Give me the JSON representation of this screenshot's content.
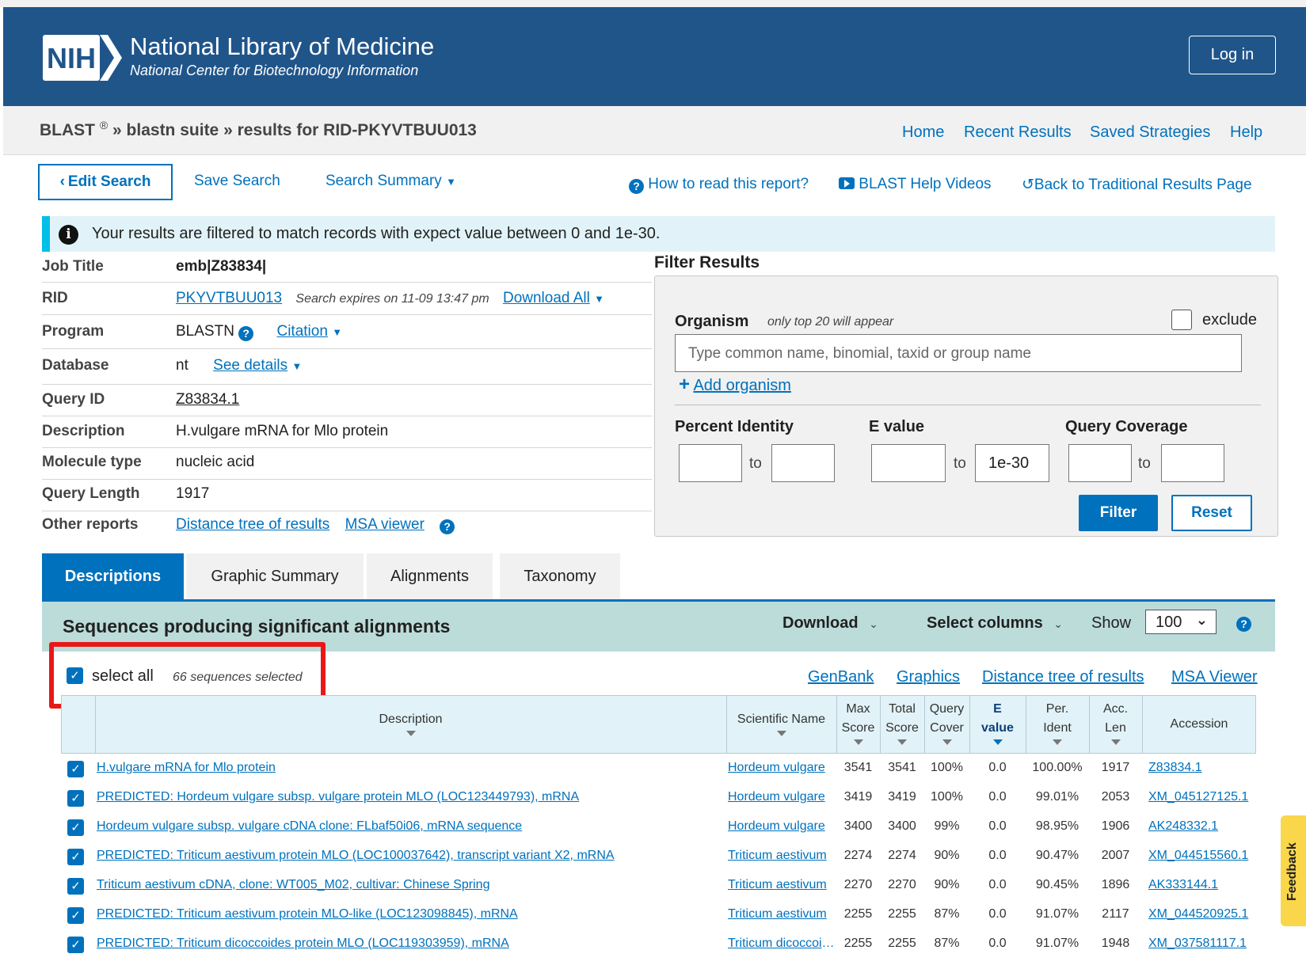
{
  "header": {
    "logo_text": "NIH",
    "title": "National Library of Medicine",
    "subtitle": "National Center for Biotechnology Information",
    "login_label": "Log in"
  },
  "breadcrumb": {
    "brand": "BLAST",
    "reg": "®",
    "sep1": "»",
    "suite": "blastn suite",
    "sep2": "»",
    "results": "results for RID-PKYVTBUU013"
  },
  "topnav": [
    "Home",
    "Recent Results",
    "Saved Strategies",
    "Help"
  ],
  "toolbar": {
    "edit_search": "Edit Search",
    "save_search": "Save Search",
    "search_summary": "Search Summary",
    "how_to_read": "How to read this report?",
    "help_videos": "BLAST Help Videos",
    "back_traditional": "Back to Traditional Results Page"
  },
  "info_banner": "Your results are filtered to match records with expect value between 0 and 1e-30.",
  "job": {
    "labels": [
      "Job Title",
      "RID",
      "Program",
      "Database",
      "Query ID",
      "Description",
      "Molecule type",
      "Query Length",
      "Other reports"
    ],
    "job_title": "emb|Z83834|",
    "rid": "PKYVTBUU013",
    "rid_expires": "Search expires on 11-09 13:47 pm",
    "download_all": "Download All",
    "program": "BLASTN",
    "citation": "Citation",
    "database": "nt",
    "see_details": "See details",
    "query_id": "Z83834.1",
    "description": "H.vulgare mRNA for Mlo protein",
    "molecule_type": "nucleic acid",
    "query_length": "1917",
    "distance_tree": "Distance tree of results",
    "msa_viewer": "MSA viewer"
  },
  "filter": {
    "title": "Filter Results",
    "organism_label": "Organism",
    "organism_hint": "only top 20 will appear",
    "exclude_label": "exclude",
    "organism_placeholder": "Type common  name, binomial, taxid or group  name",
    "add_organism": "Add organism",
    "percent_identity": "Percent Identity",
    "e_value": "E value",
    "query_coverage": "Query Coverage",
    "to": "to",
    "e_value_to": "1e-30",
    "filter_btn": "Filter",
    "reset_btn": "Reset"
  },
  "tabs": [
    "Descriptions",
    "Graphic Summary",
    "Alignments",
    "Taxonomy"
  ],
  "results": {
    "title": "Sequences producing significant alignments",
    "download": "Download",
    "select_columns": "Select columns",
    "show": "Show",
    "show_value": "100",
    "select_all": "select all",
    "selected_count": "66 sequences selected",
    "links": [
      "GenBank",
      "Graphics",
      "Distance tree of results",
      "MSA Viewer"
    ]
  },
  "table": {
    "headers": {
      "description": "Description",
      "scientific_name": "Scientific Name",
      "max_score": [
        "Max",
        "Score"
      ],
      "total_score": [
        "Total",
        "Score"
      ],
      "query_cover": [
        "Query",
        "Cover"
      ],
      "e_value": [
        "E",
        "value"
      ],
      "per_ident": [
        "Per.",
        "Ident"
      ],
      "acc_len": [
        "Acc.",
        "Len"
      ],
      "accession": "Accession"
    },
    "rows": [
      {
        "desc": "H.vulgare mRNA for Mlo protein",
        "sci": "Hordeum vulgare",
        "max": "3541",
        "total": "3541",
        "cover": "100%",
        "e": "0.0",
        "ident": "100.00%",
        "len": "1917",
        "acc": "Z83834.1"
      },
      {
        "desc": "PREDICTED: Hordeum vulgare subsp. vulgare protein MLO (LOC123449793), mRNA",
        "sci": "Hordeum vulgare",
        "max": "3419",
        "total": "3419",
        "cover": "100%",
        "e": "0.0",
        "ident": "99.01%",
        "len": "2053",
        "acc": "XM_045127125.1"
      },
      {
        "desc": "Hordeum vulgare subsp. vulgare cDNA clone: FLbaf50i06, mRNA sequence",
        "sci": "Hordeum vulgare",
        "max": "3400",
        "total": "3400",
        "cover": "99%",
        "e": "0.0",
        "ident": "98.95%",
        "len": "1906",
        "acc": "AK248332.1"
      },
      {
        "desc": "PREDICTED: Triticum aestivum protein MLO (LOC100037642), transcript variant X2, mRNA",
        "sci": "Triticum aestivum",
        "max": "2274",
        "total": "2274",
        "cover": "90%",
        "e": "0.0",
        "ident": "90.47%",
        "len": "2007",
        "acc": "XM_044515560.1"
      },
      {
        "desc": "Triticum aestivum cDNA, clone: WT005_M02, cultivar: Chinese Spring",
        "sci": "Triticum aestivum",
        "max": "2270",
        "total": "2270",
        "cover": "90%",
        "e": "0.0",
        "ident": "90.45%",
        "len": "1896",
        "acc": "AK333144.1"
      },
      {
        "desc": "PREDICTED: Triticum aestivum protein MLO-like (LOC123098845), mRNA",
        "sci": "Triticum aestivum",
        "max": "2255",
        "total": "2255",
        "cover": "87%",
        "e": "0.0",
        "ident": "91.07%",
        "len": "2117",
        "acc": "XM_044520925.1"
      },
      {
        "desc": "PREDICTED: Triticum dicoccoides protein MLO (LOC119303959), mRNA",
        "sci": "Triticum dicoccoides",
        "max": "2255",
        "total": "2255",
        "cover": "87%",
        "e": "0.0",
        "ident": "91.07%",
        "len": "1948",
        "acc": "XM_037581117.1"
      }
    ]
  },
  "feedback": "Feedback",
  "colors": {
    "nih_blue": "#20558a",
    "link_blue": "#0071bc",
    "banner_bg": "#e1f3f8",
    "highlight_red": "#e81818"
  }
}
